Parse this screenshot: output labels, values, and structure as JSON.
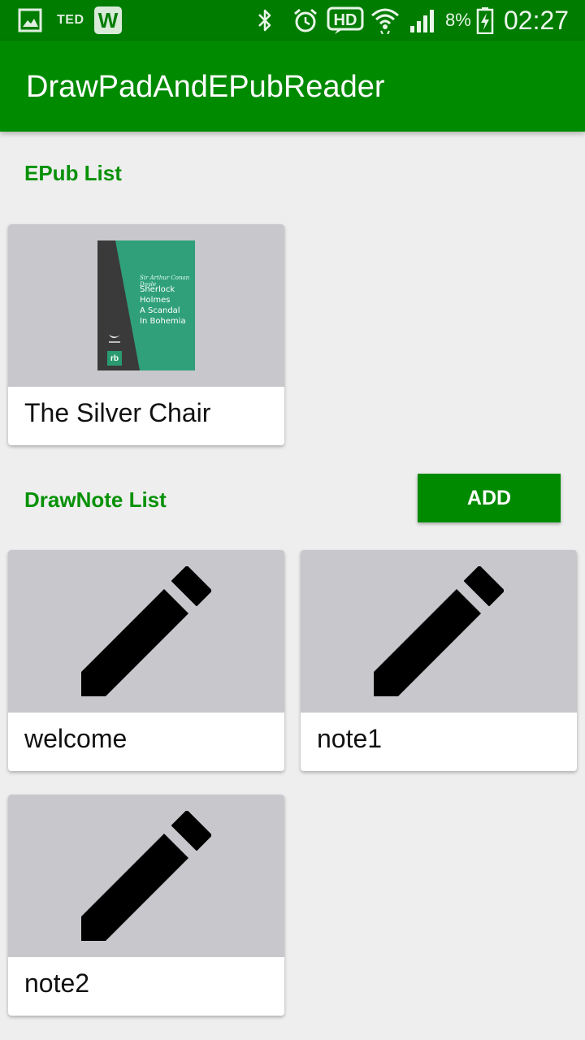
{
  "status_bar": {
    "icons": [
      "gallery-icon",
      "ted-icon",
      "w-app-icon",
      "bluetooth-icon",
      "alarm-icon",
      "hd-icon",
      "wifi-icon",
      "signal-icon",
      "battery-charging-icon"
    ],
    "ted": "TED",
    "w_app": "W",
    "hd": "HD",
    "battery_percent": "8%",
    "time": "02:27"
  },
  "app_bar": {
    "title": "DrawPadAndEPubReader"
  },
  "epub_section": {
    "title": "EPub List",
    "items": [
      {
        "label": "The Silver Chair",
        "cover": {
          "author": "Sir Arthur Conan Doyle",
          "lines": [
            "Sherlock",
            "Holmes",
            "A Scandal",
            "In Bohemia"
          ],
          "publisher": "rb"
        }
      }
    ]
  },
  "drawnote_section": {
    "title": "DrawNote List",
    "add_label": "ADD",
    "items": [
      {
        "label": "welcome",
        "icon": "pencil-icon"
      },
      {
        "label": "note1",
        "icon": "pencil-icon"
      },
      {
        "label": "note2",
        "icon": "pencil-icon"
      }
    ]
  },
  "colors": {
    "status_bar": "#007c00",
    "app_bar": "#008a00",
    "accent_text": "#079107",
    "thumb_bg": "#c7c7cc",
    "background": "#eeeeee"
  }
}
